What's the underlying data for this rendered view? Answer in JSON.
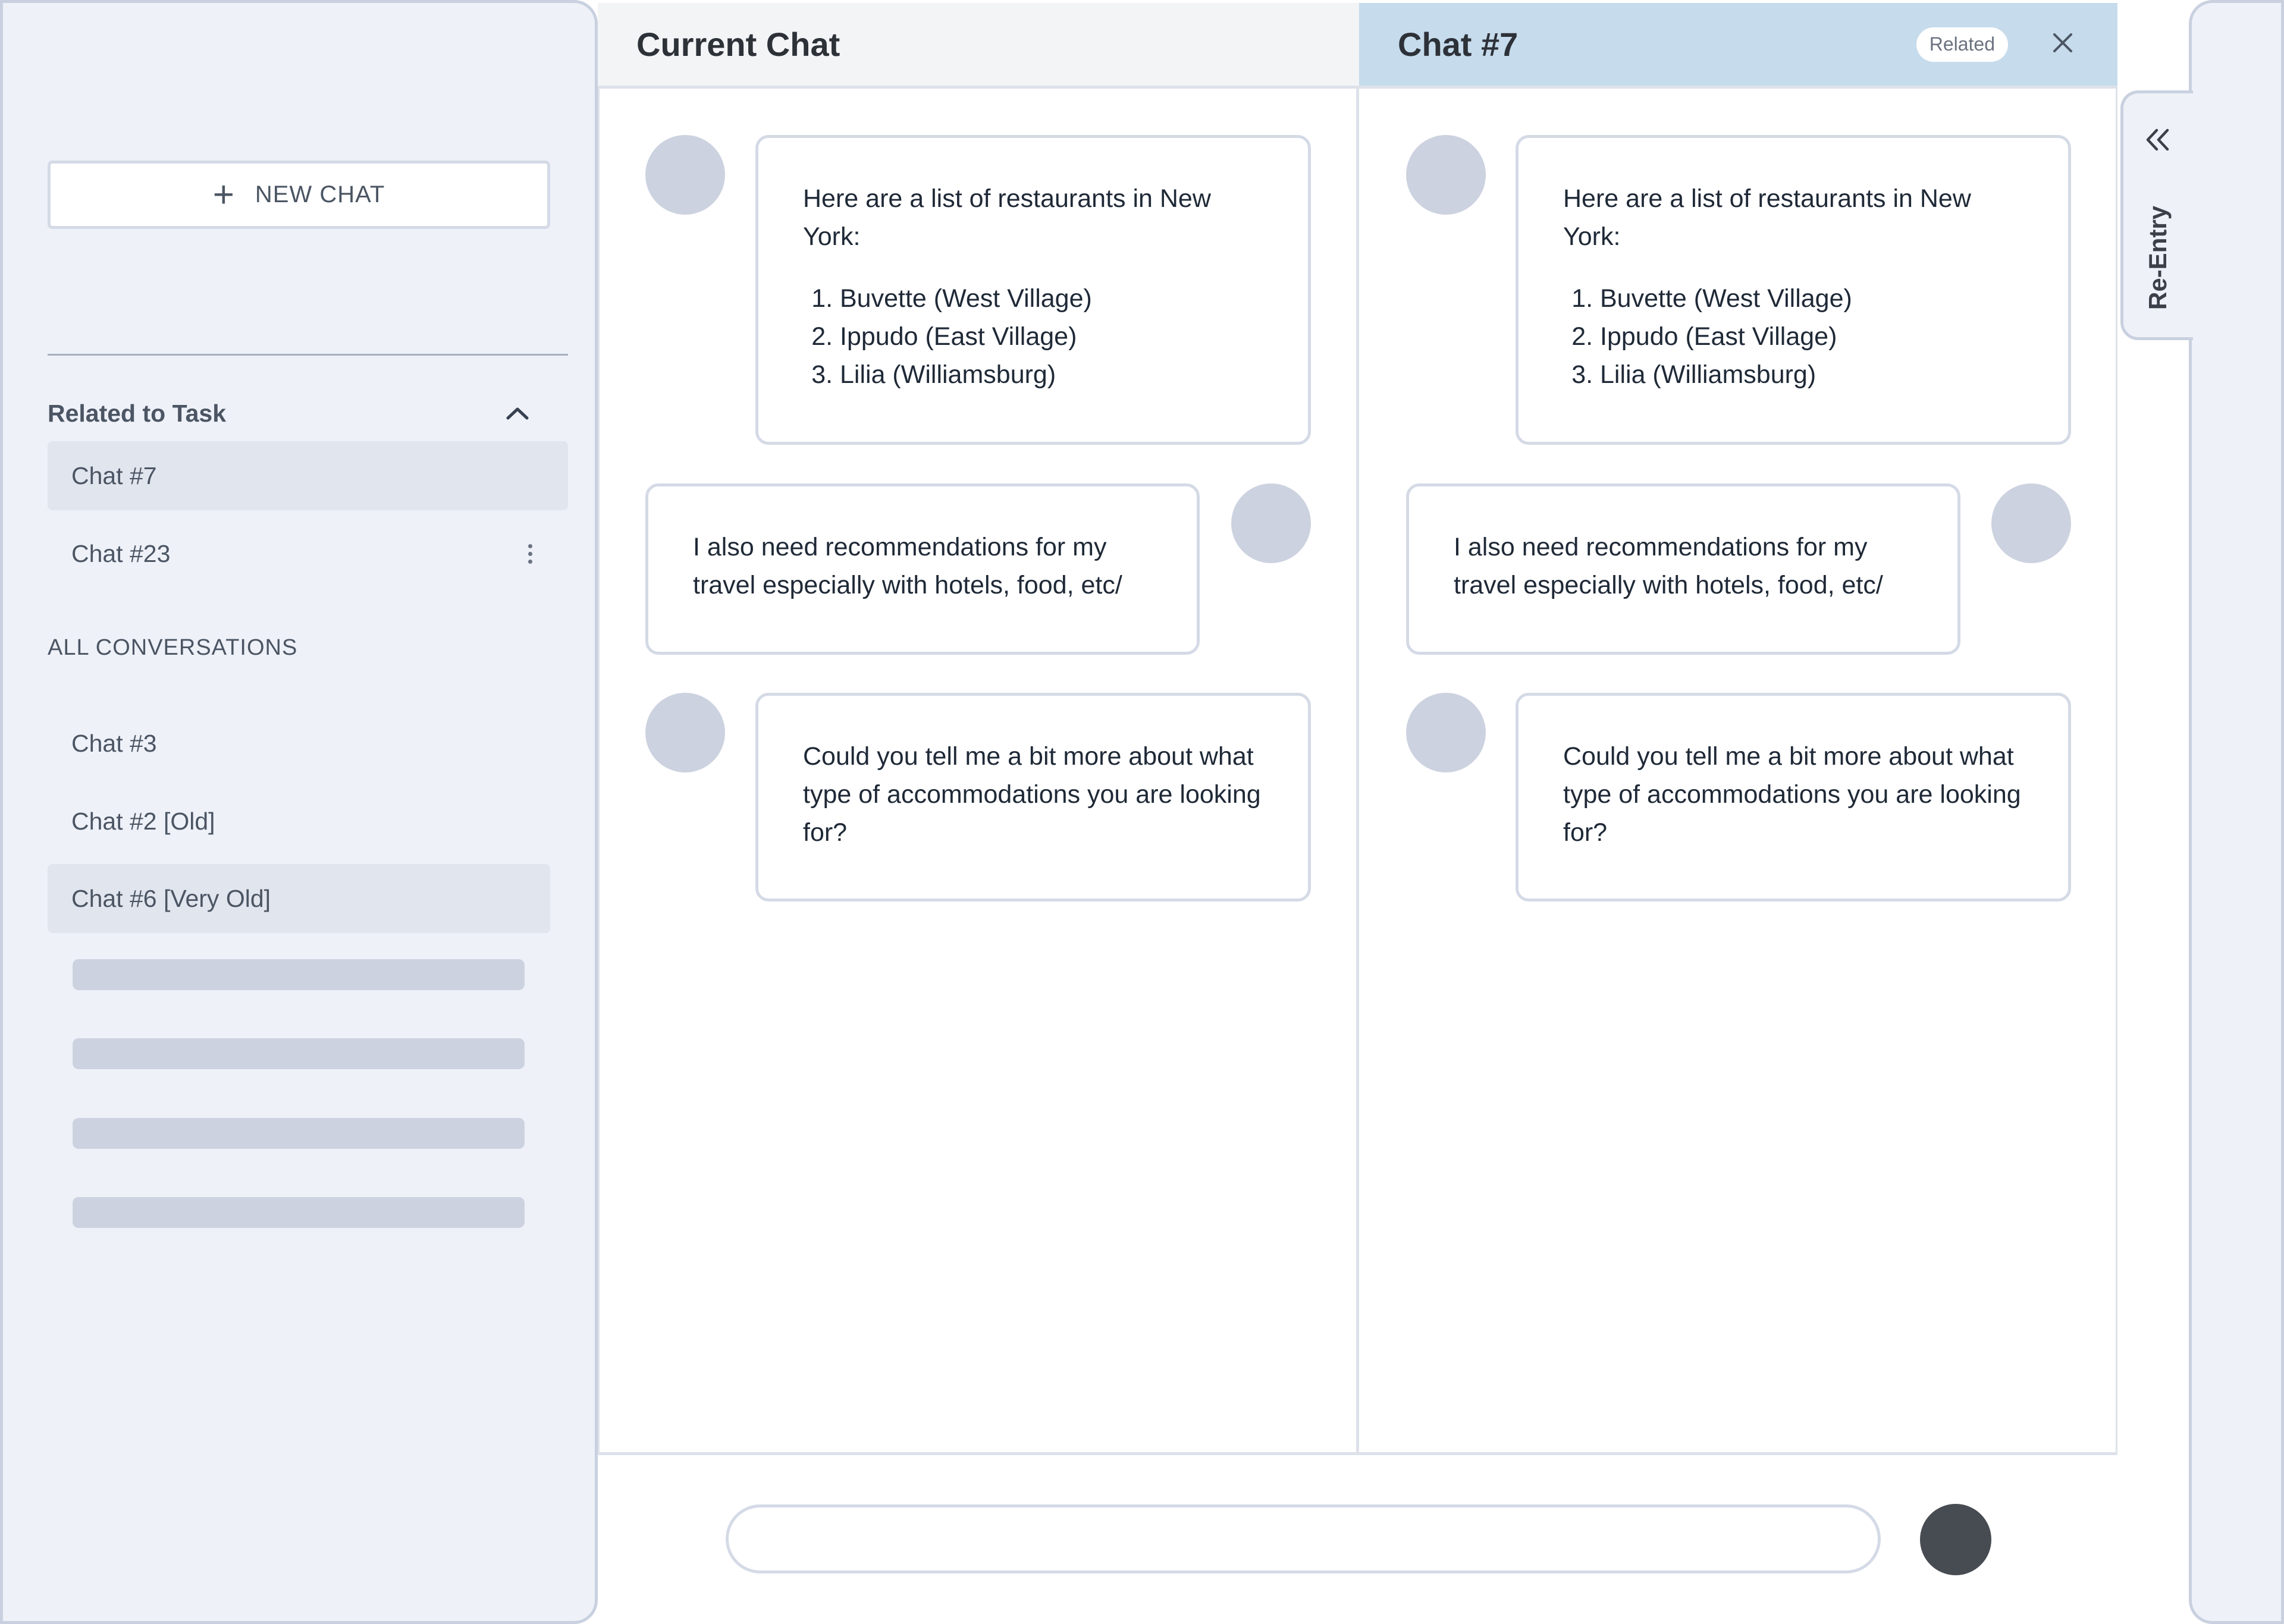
{
  "sidebar": {
    "new_chat_label": "NEW CHAT",
    "related_section_title": "Related to Task",
    "related_items": [
      {
        "label": "Chat #7"
      },
      {
        "label": "Chat #23"
      }
    ],
    "all_conversations_title": "ALL CONVERSATIONS",
    "all_items": [
      {
        "label": "Chat #3"
      },
      {
        "label": "Chat #2 [Old]"
      },
      {
        "label": "Chat #6 [Very Old]"
      }
    ]
  },
  "current_pane": {
    "title": "Current Chat",
    "messages": [
      {
        "role": "assistant",
        "intro": "Here are a list of restaurants in New York:",
        "list": [
          "Buvette (West Village)",
          "Ippudo (East Village)",
          "Lilia (Williamsburg)"
        ]
      },
      {
        "role": "user",
        "text": "I also need recommendations for my travel especially with hotels, food, etc/"
      },
      {
        "role": "assistant",
        "text": "Could you tell me a bit more about what type of accommodations you are looking for?"
      }
    ]
  },
  "related_pane": {
    "title": "Chat #7",
    "badge": "Related",
    "messages": [
      {
        "role": "assistant",
        "intro": "Here are a list of restaurants in New York:",
        "list": [
          "Buvette (West Village)",
          "Ippudo (East Village)",
          "Lilia (Williamsburg)"
        ]
      },
      {
        "role": "user",
        "text": "I also need recommendations for my travel especially with hotels, food, etc/"
      },
      {
        "role": "assistant",
        "text": "Could you tell me a bit more about what type of accommodations you are looking for?"
      }
    ]
  },
  "composer": {
    "value": "",
    "placeholder": ""
  },
  "reentry": {
    "label": "Re-Entry"
  },
  "colors": {
    "sidebar_bg": "#eef1f8",
    "related_header_bg": "#c6dbeb",
    "send_button": "#474b52"
  }
}
